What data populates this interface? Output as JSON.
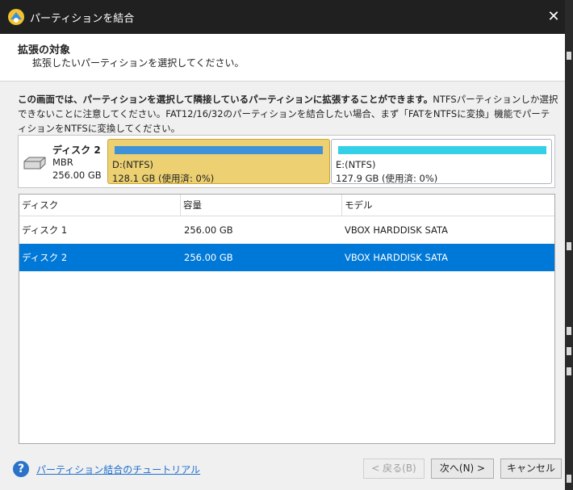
{
  "window": {
    "title": "パーティションを結合",
    "close_glyph": "✕"
  },
  "header": {
    "title": "拡張の対象",
    "subtitle": "拡張したいパーティションを選択してください。"
  },
  "description": {
    "bold": "この画面では、パーティションを選択して隣接しているパーティションに拡張することができます。",
    "rest": "NTFSパーティションしか選択できないことに注意してください。FAT12/16/32のパーティションを結合したい場合、まず「FATをNTFSに変換」機能でパーティションをNTFSに変換してください。"
  },
  "disk_map": {
    "name": "ディスク 2",
    "type": "MBR",
    "size": "256.00 GB",
    "partitions": [
      {
        "label": "D:(NTFS)",
        "info": "128.1 GB (使用済: 0%)",
        "selected": true,
        "used_fraction": 0
      },
      {
        "label": "E:(NTFS)",
        "info": "127.9 GB (使用済: 0%)",
        "selected": false,
        "used_fraction": 0
      }
    ]
  },
  "table": {
    "headers": [
      "ディスク",
      "容量",
      "モデル"
    ],
    "rows": [
      {
        "disk": "ディスク 1",
        "capacity": "256.00 GB",
        "model": "VBOX HARDDISK SATA",
        "selected": false
      },
      {
        "disk": "ディスク 2",
        "capacity": "256.00 GB",
        "model": "VBOX HARDDISK SATA",
        "selected": true
      }
    ]
  },
  "footer": {
    "help_glyph": "?",
    "help_link": "パーティション結合のチュートリアル",
    "back_label": "< 戻る(B)",
    "next_label": "次へ(N) >",
    "cancel_label": "キャンセル"
  },
  "colors": {
    "selection": "#0078d7",
    "partition_selected_bg": "#ecd071",
    "partition_d_bar": "#3f91d8",
    "partition_e_bar": "#33d0e8"
  }
}
